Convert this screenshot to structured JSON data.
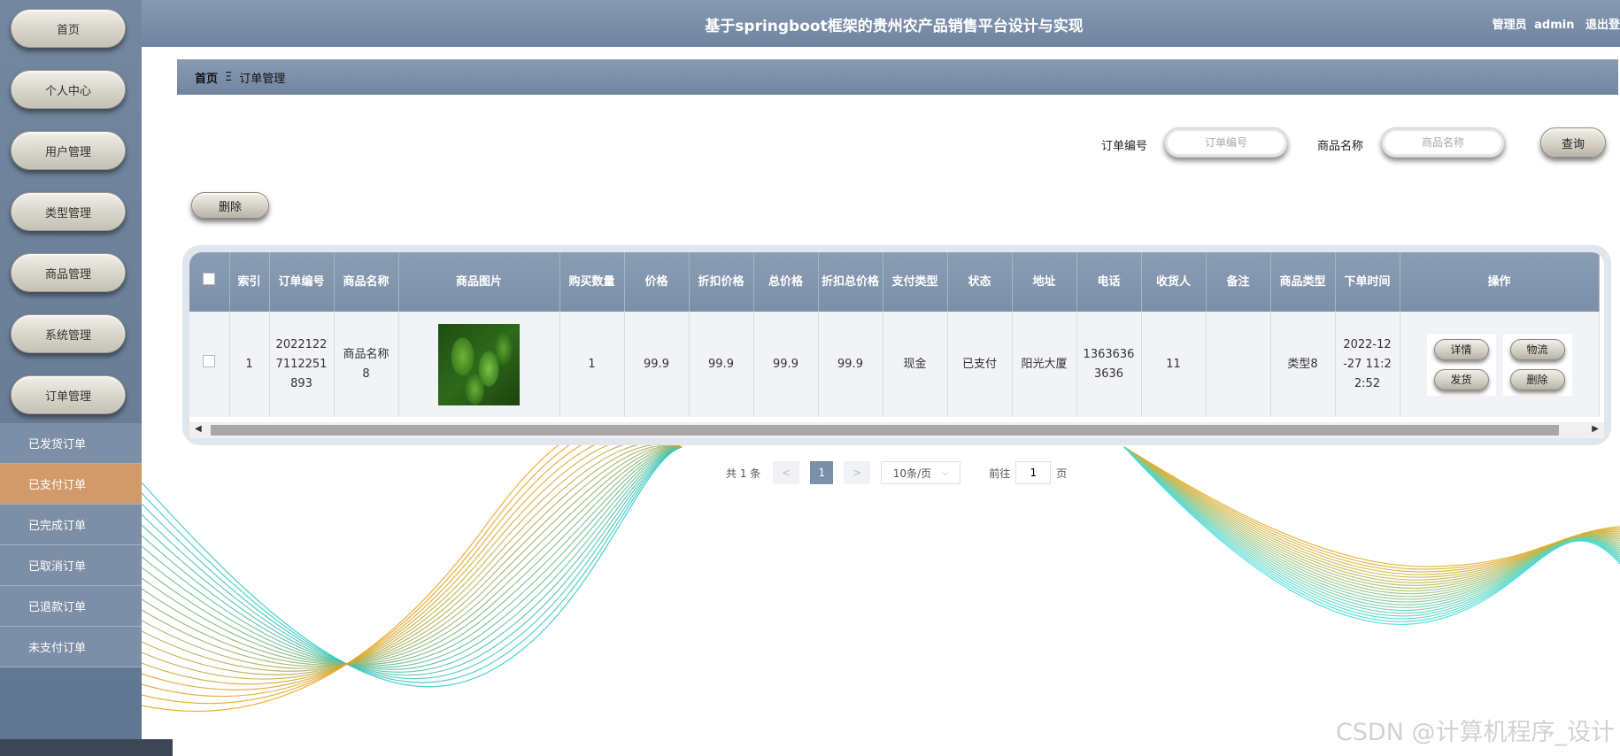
{
  "app": {
    "title": "基于springboot框架的贵州农产品销售平台设计与实现",
    "user_role": "管理员",
    "username": "admin",
    "logout": "退出登"
  },
  "sidebar": {
    "items": [
      {
        "label": "首页"
      },
      {
        "label": "个人中心"
      },
      {
        "label": "用户管理"
      },
      {
        "label": "类型管理"
      },
      {
        "label": "商品管理"
      },
      {
        "label": "系统管理"
      },
      {
        "label": "订单管理"
      }
    ],
    "submenu": [
      {
        "label": "已发货订单"
      },
      {
        "label": "已支付订单",
        "active": true
      },
      {
        "label": "已完成订单"
      },
      {
        "label": "已取消订单"
      },
      {
        "label": "已退款订单"
      },
      {
        "label": "未支付订单"
      }
    ]
  },
  "breadcrumb": {
    "home": "首页",
    "separator": "Ξ",
    "current": "订单管理"
  },
  "search": {
    "order_no_label": "订单编号",
    "order_no_placeholder": "订单编号",
    "product_name_label": "商品名称",
    "product_name_placeholder": "商品名称",
    "query_button": "查询"
  },
  "toolbar": {
    "delete_button": "删除"
  },
  "table": {
    "columns": [
      "索引",
      "订单编号",
      "商品名称",
      "商品图片",
      "购买数量",
      "价格",
      "折扣价格",
      "总价格",
      "折扣总价格",
      "支付类型",
      "状态",
      "地址",
      "电话",
      "收货人",
      "备注",
      "商品类型",
      "下单时间",
      "操作"
    ],
    "rows": [
      {
        "index": "1",
        "order_no": "20221227112251893",
        "product_name": "商品名称8",
        "quantity": "1",
        "price": "99.9",
        "discount_price": "99.9",
        "total_price": "99.9",
        "discount_total": "99.9",
        "pay_type": "现金",
        "status": "已支付",
        "address": "阳光大厦",
        "phone": "13636363636",
        "receiver": "11",
        "remark": "",
        "product_type": "类型8",
        "order_time": "2022-12-27 11:22:52",
        "actions": {
          "detail": "详情",
          "ship": "发货",
          "logistics": "物流",
          "delete": "删除"
        }
      }
    ]
  },
  "pagination": {
    "total_text": "共 1 条",
    "prev": "<",
    "current_page": "1",
    "next": ">",
    "page_size": "10条/页",
    "goto_label": "前往",
    "goto_value": "1",
    "page_unit": "页"
  },
  "watermark": "CSDN @计算机程序_设计",
  "colors": {
    "sidebar": "#6f849d",
    "active_submenu": "#d29a6a",
    "header": "#7b8fa8"
  }
}
